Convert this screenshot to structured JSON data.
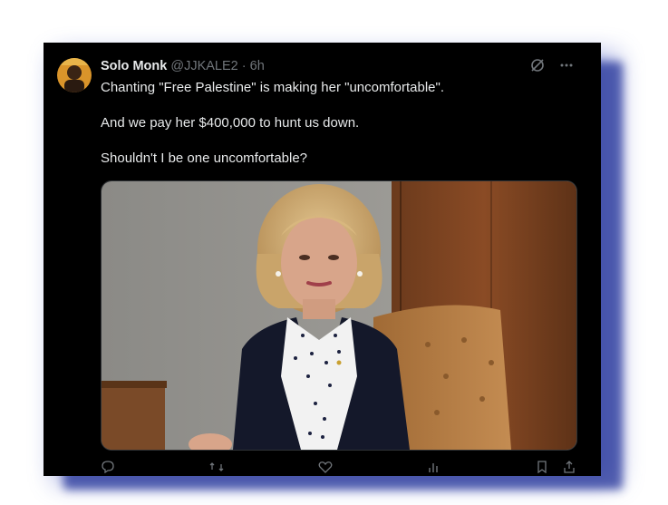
{
  "tweet": {
    "author_name": "Solo Monk",
    "handle": "@JJKALE2",
    "separator": "·",
    "time": "6h",
    "line1": "Chanting \"Free Palestine\" is making her \"uncomfortable\".",
    "line2": "And we pay her $400,000 to hunt us down.",
    "line3": "Shouldn't I be one uncomfortable?"
  },
  "icons": {
    "grok": "grok-icon",
    "more": "more-options-icon",
    "reply": "reply-icon",
    "retweet": "retweet-icon",
    "like": "like-icon",
    "views": "views-icon",
    "bookmark": "bookmark-icon",
    "share": "share-icon"
  },
  "colors": {
    "background": "#000000",
    "text": "#e7e9ea",
    "muted": "#71767b",
    "frame_shadow": "#3b4db0"
  }
}
